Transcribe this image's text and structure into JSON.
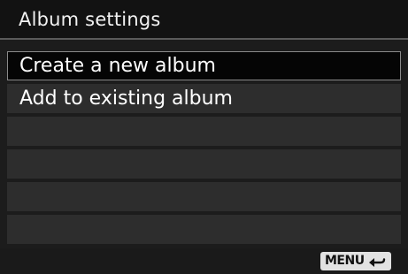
{
  "header": {
    "title": "Album settings"
  },
  "menu": {
    "items": [
      {
        "label": "Create a new album",
        "selected": true
      },
      {
        "label": "Add to existing album",
        "selected": false
      },
      {
        "label": "",
        "selected": false
      },
      {
        "label": "",
        "selected": false
      },
      {
        "label": "",
        "selected": false
      },
      {
        "label": "",
        "selected": false
      }
    ]
  },
  "footer": {
    "menu_button_label": "MENU",
    "back_icon": "return-arrow-icon"
  },
  "colors": {
    "background": "#1c1c1c",
    "row": "#2d2d2d",
    "selected_row": "#050505",
    "text": "#ffffff",
    "badge": "#e2e2e2"
  }
}
